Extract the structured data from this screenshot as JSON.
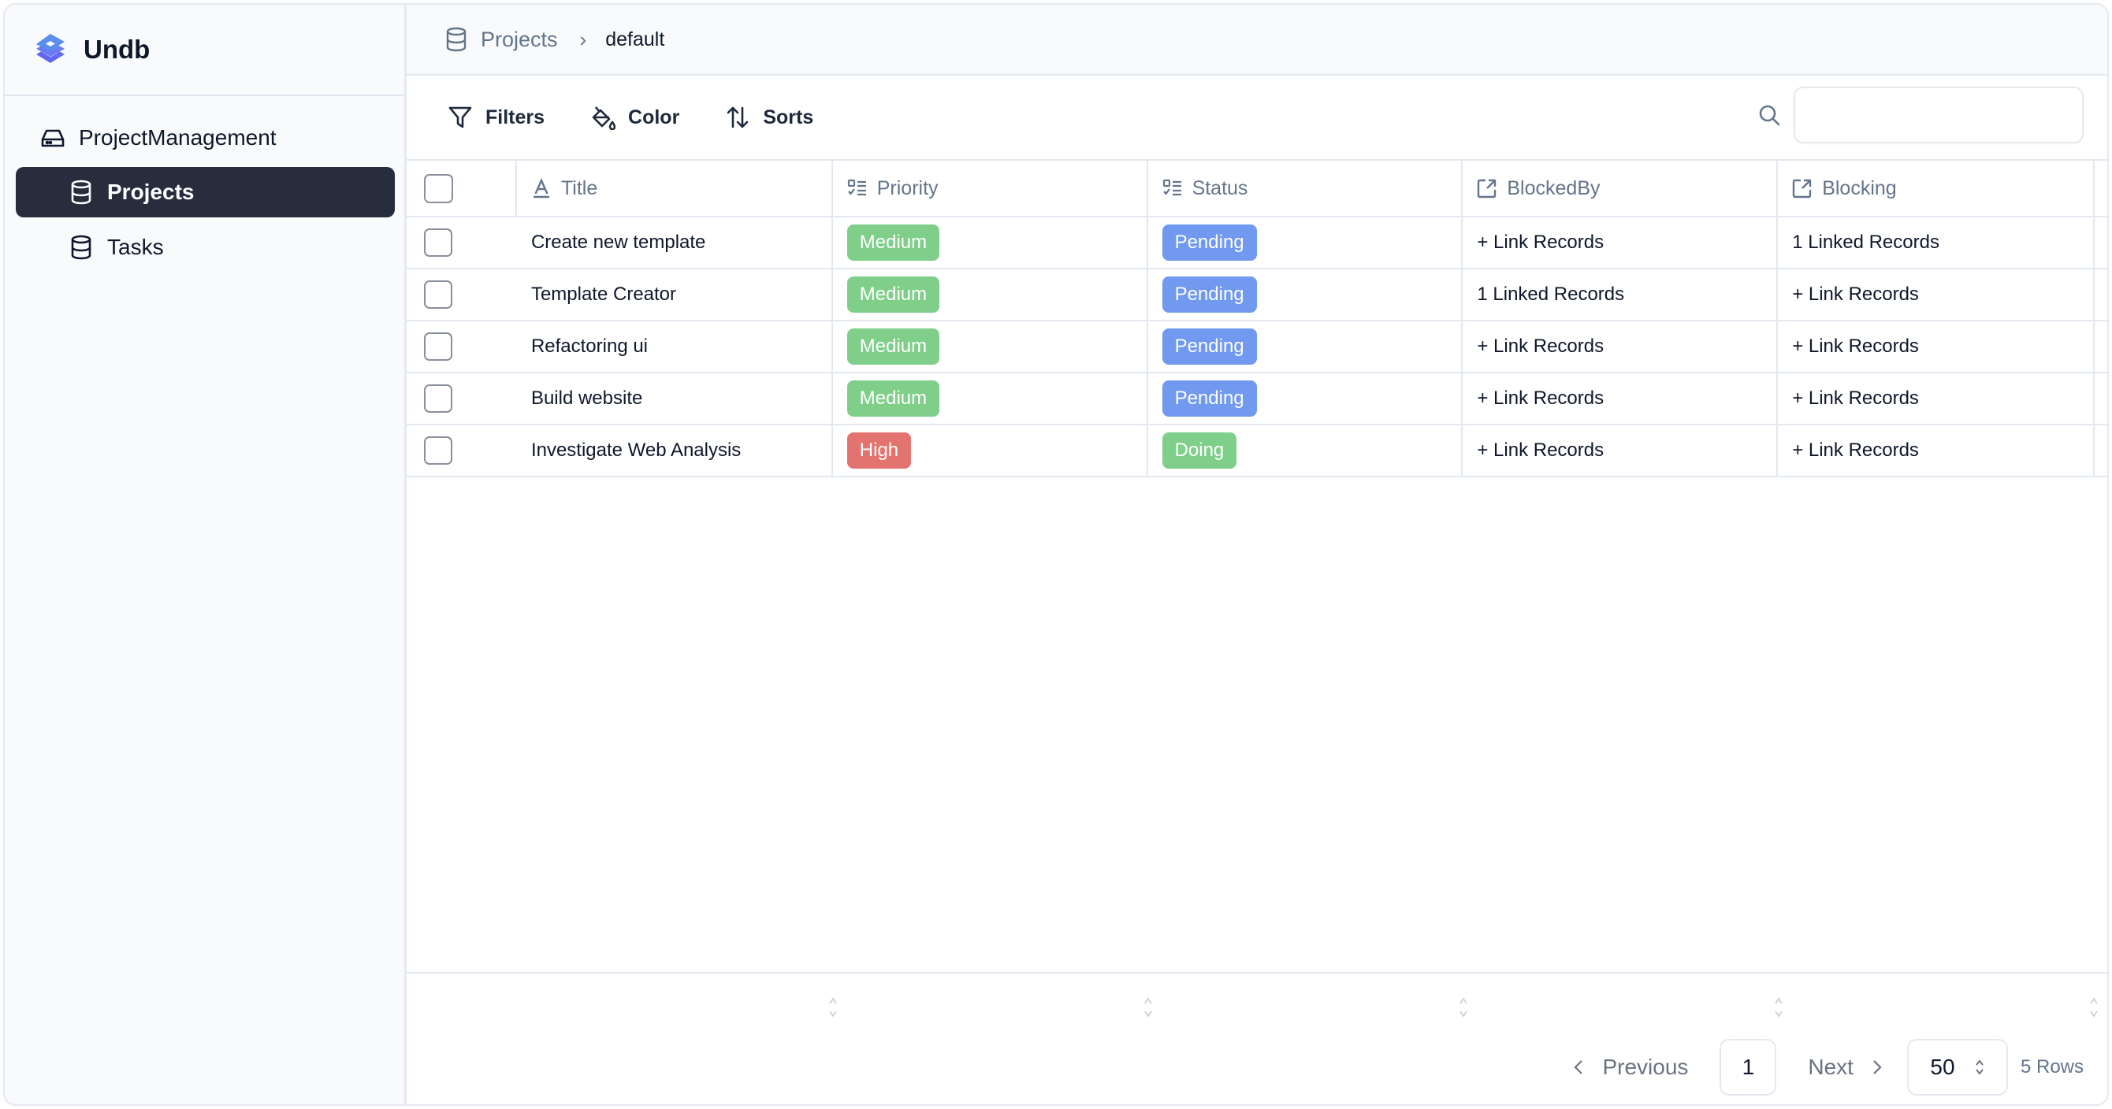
{
  "app": {
    "name": "Undb",
    "brand_color": "#6366f1"
  },
  "sidebar": {
    "database": {
      "label": "ProjectManagement",
      "icon": "database-drive-icon"
    },
    "tables": [
      {
        "label": "Projects",
        "icon": "database-icon",
        "active": true
      },
      {
        "label": "Tasks",
        "icon": "database-icon",
        "active": false
      }
    ]
  },
  "breadcrumb": {
    "table": "Projects",
    "separator": ">",
    "view": "default"
  },
  "toolbar": {
    "filters_label": "Filters",
    "color_label": "Color",
    "sorts_label": "Sorts",
    "search_value": "",
    "search_placeholder": ""
  },
  "table": {
    "columns": [
      {
        "label": "Title",
        "icon": "text-field-icon"
      },
      {
        "label": "Priority",
        "icon": "select-field-icon"
      },
      {
        "label": "Status",
        "icon": "select-field-icon"
      },
      {
        "label": "BlockedBy",
        "icon": "link-field-icon"
      },
      {
        "label": "Blocking",
        "icon": "link-field-icon"
      }
    ],
    "rows": [
      {
        "title": "Create new template",
        "priority": "Medium",
        "status": "Pending",
        "blocked_by": "+ Link Records",
        "blocking": "1 Linked Records"
      },
      {
        "title": "Template Creator",
        "priority": "Medium",
        "status": "Pending",
        "blocked_by": "1 Linked Records",
        "blocking": "+ Link Records"
      },
      {
        "title": "Refactoring ui",
        "priority": "Medium",
        "status": "Pending",
        "blocked_by": "+ Link Records",
        "blocking": "+ Link Records"
      },
      {
        "title": "Build website",
        "priority": "Medium",
        "status": "Pending",
        "blocked_by": "+ Link Records",
        "blocking": "+ Link Records"
      },
      {
        "title": "Investigate Web Analysis",
        "priority": "High",
        "status": "Doing",
        "blocked_by": "+ Link Records",
        "blocking": "+ Link Records"
      }
    ],
    "option_colors": {
      "Medium": "#7fcf8a",
      "High": "#e3736e",
      "Pending": "#7199ef",
      "Doing": "#7fcf8a"
    }
  },
  "pagination": {
    "previous_label": "Previous",
    "next_label": "Next",
    "current_page": "1",
    "page_size": "50",
    "total_label": "5 Rows"
  }
}
